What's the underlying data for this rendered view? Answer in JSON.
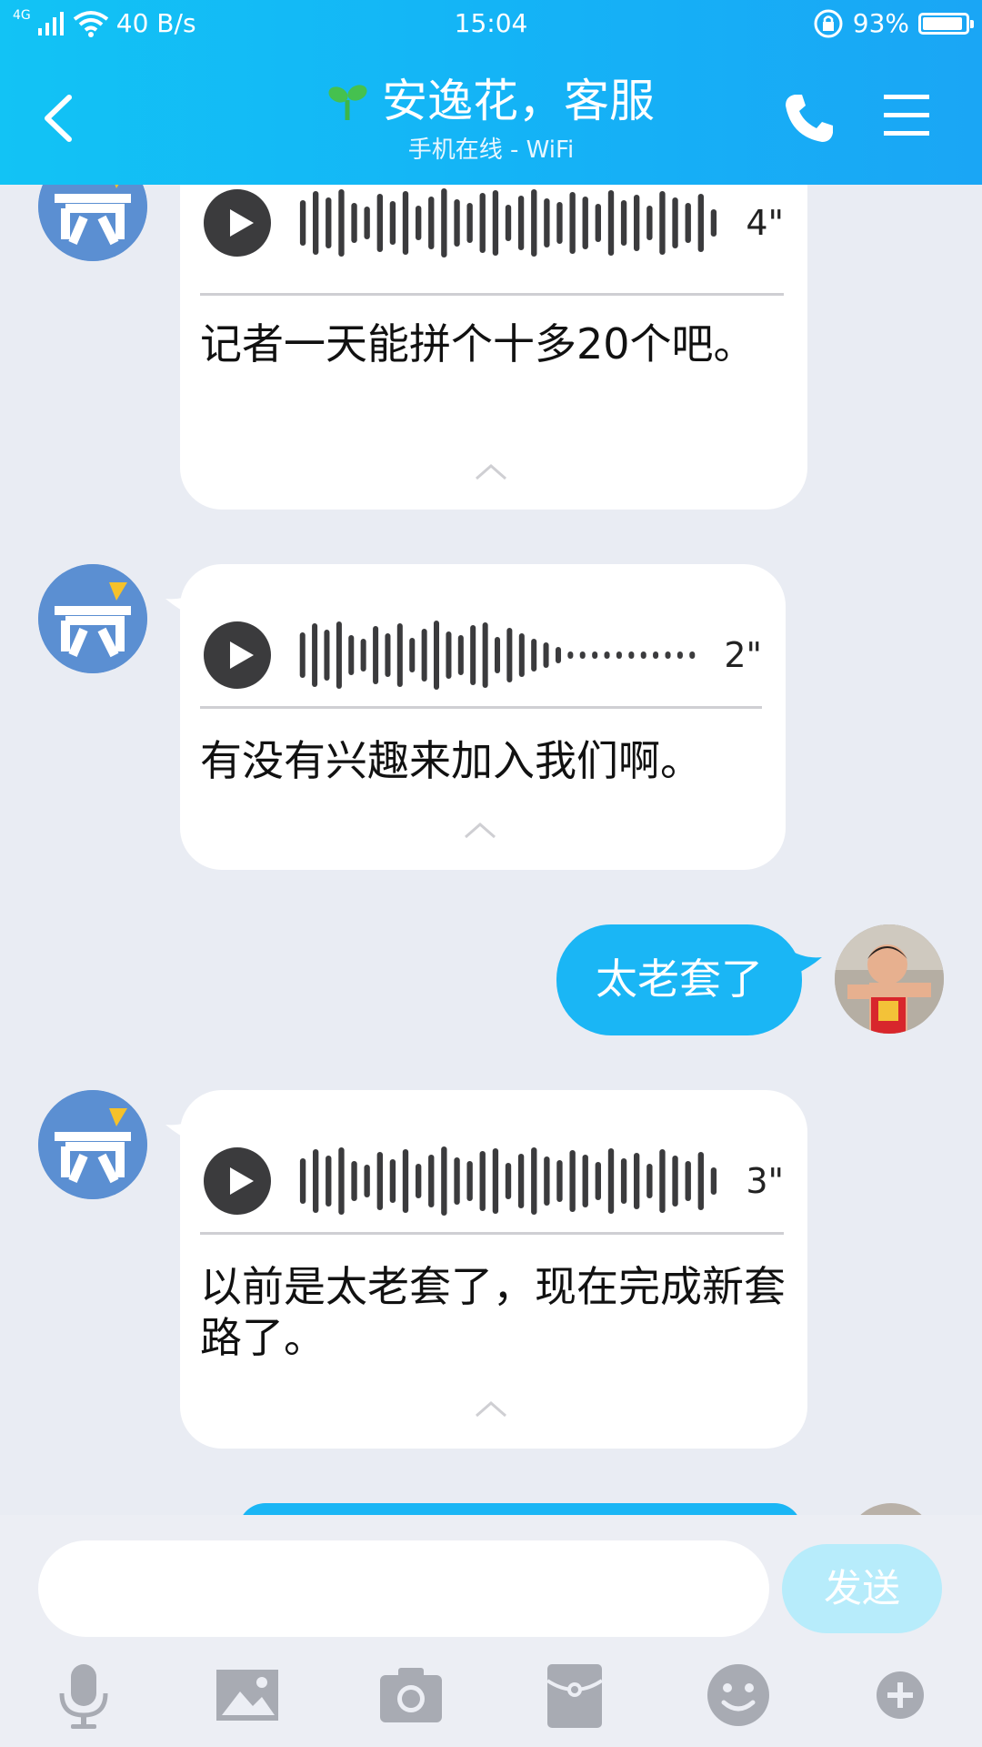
{
  "status_bar": {
    "network": "4G",
    "speed": "40 B/s",
    "time": "15:04",
    "battery": "93%",
    "battery_level": 0.93
  },
  "header": {
    "title": "安逸花，客服",
    "subtitle": "手机在线 - WiFi"
  },
  "messages": [
    {
      "type": "voice",
      "side": "incoming",
      "duration": "4\"",
      "transcript": "记者一天能拼个十多20个吧。"
    },
    {
      "type": "voice",
      "side": "incoming",
      "duration": "2\"",
      "transcript": "有没有兴趣来加入我们啊。"
    },
    {
      "type": "text",
      "side": "outgoing",
      "text": "太老套了"
    },
    {
      "type": "voice",
      "side": "incoming",
      "duration": "3\"",
      "transcript": "以前是太老套了，现在完成新套路了。"
    }
  ],
  "input": {
    "placeholder": "",
    "value": "",
    "send_label": "发送"
  },
  "toolbar": [
    "microphone-icon",
    "image-icon",
    "camera-icon",
    "red-packet-icon",
    "emoji-icon",
    "plus-icon"
  ],
  "colors": {
    "header_start": "#12c3f5",
    "header_end": "#1aa6f5",
    "outgoing_bubble": "#1ab6f5",
    "background": "#e9ecf3",
    "send_disabled": "#b7ecfb"
  }
}
